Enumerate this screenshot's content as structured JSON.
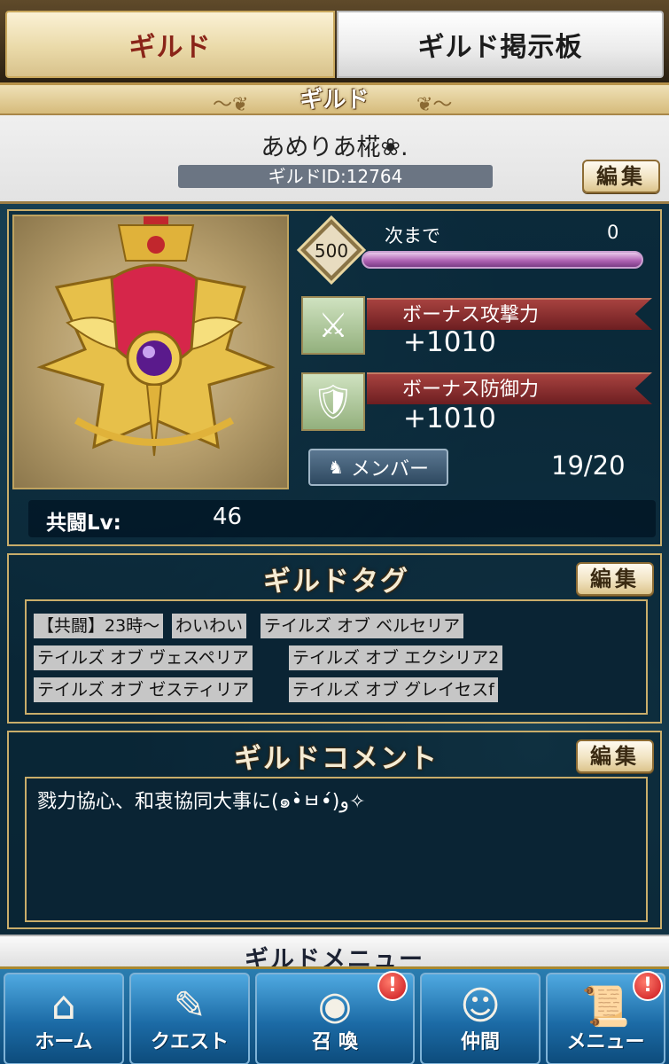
{
  "tabs": {
    "guild": "ギルド",
    "board": "ギルド掲示板"
  },
  "header": {
    "title": "ギルド",
    "guild_name": "あめりあ椛❀.",
    "guild_id": "ギルドID:12764",
    "edit_label": "編集"
  },
  "info": {
    "level": "500",
    "exp_label": "次まで",
    "exp_value": "0",
    "exp_fraction": 0.97,
    "attack_label": "ボーナス攻撃力",
    "attack_value": "+1010",
    "defense_label": "ボーナス防御力",
    "defense_value": "+1010",
    "member_label": "メンバー",
    "member_count": "19/20",
    "coop_label": "共闘Lv:",
    "coop_value": "46"
  },
  "tags": {
    "title": "ギルドタグ",
    "edit_label": "編集",
    "items": [
      "【共闘】23時～",
      "わいわい",
      "テイルズ オブ ベルセリア",
      "テイルズ オブ ヴェスペリア",
      "テイルズ オブ エクシリア2",
      "テイルズ オブ ゼスティリア",
      "テイルズ オブ グレイセスf"
    ]
  },
  "comment": {
    "title": "ギルドコメント",
    "edit_label": "編集",
    "text": "戮力協心、和衷協同大事に(๑•̀ㅂ•́)و✧"
  },
  "menu": {
    "label": "ギルドメニュー",
    "home": "ホーム",
    "quest": "クエスト",
    "summon": "召 喚",
    "friends": "仲間",
    "menu": "メニュー",
    "alert": "!"
  },
  "colors": {
    "accent_gold": "#c9ad6a",
    "tab_active_text": "#8a2418",
    "exp_bar": "#b064b4",
    "alert": "#c8141c"
  }
}
